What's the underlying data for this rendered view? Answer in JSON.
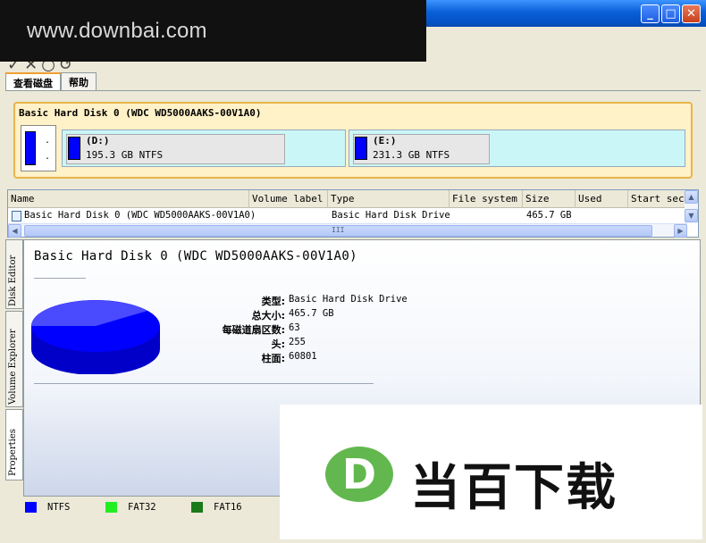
{
  "watermark": {
    "text": "www.downbai.com"
  },
  "window": {
    "buttons": [
      "_",
      "□",
      "✕"
    ]
  },
  "tabs": [
    {
      "label": "查看磁盘",
      "active": true
    },
    {
      "label": "帮助",
      "active": false
    }
  ],
  "disk_map": {
    "title": "Basic Hard Disk 0 (WDC WD5000AAKS-00V1A0)",
    "mini_dots": ". .",
    "partitions": [
      {
        "label": "(D:)",
        "size": "195.3 GB NTFS"
      },
      {
        "label": "(E:)",
        "size": "231.3 GB NTFS"
      }
    ]
  },
  "list": {
    "columns": [
      "Name",
      "Volume label",
      "Type",
      "File system",
      "Size",
      "Used",
      "Start sect"
    ],
    "rows": [
      {
        "name": "Basic Hard Disk 0 (WDC WD5000AAKS-00V1A0)",
        "volume_label": "",
        "type": "Basic Hard Disk Drive",
        "file_system": "",
        "size": "465.7 GB",
        "used": "",
        "start": ""
      }
    ],
    "hscroll_grip": "III"
  },
  "side_tabs": [
    "Disk Editor",
    "Volume Explorer",
    "Properties"
  ],
  "properties": {
    "title": "Basic Hard Disk 0 (WDC WD5000AAKS-00V1A0)",
    "fields": [
      {
        "key": "类型:",
        "value": "Basic Hard Disk Drive"
      },
      {
        "key": "总大小:",
        "value": "465.7 GB"
      },
      {
        "key": "每磁道扇区数:",
        "value": "63"
      },
      {
        "key": "头:",
        "value": "255"
      },
      {
        "key": "柱面:",
        "value": "60801"
      }
    ]
  },
  "legend": [
    {
      "label": "NTFS",
      "color": "#0000ff"
    },
    {
      "label": "FAT32",
      "color": "#22ee22"
    },
    {
      "label": "FAT16",
      "color": "#1a7a1a"
    }
  ],
  "logo": {
    "letter": "D",
    "text": "当百下载",
    "color": "#62b84e"
  }
}
